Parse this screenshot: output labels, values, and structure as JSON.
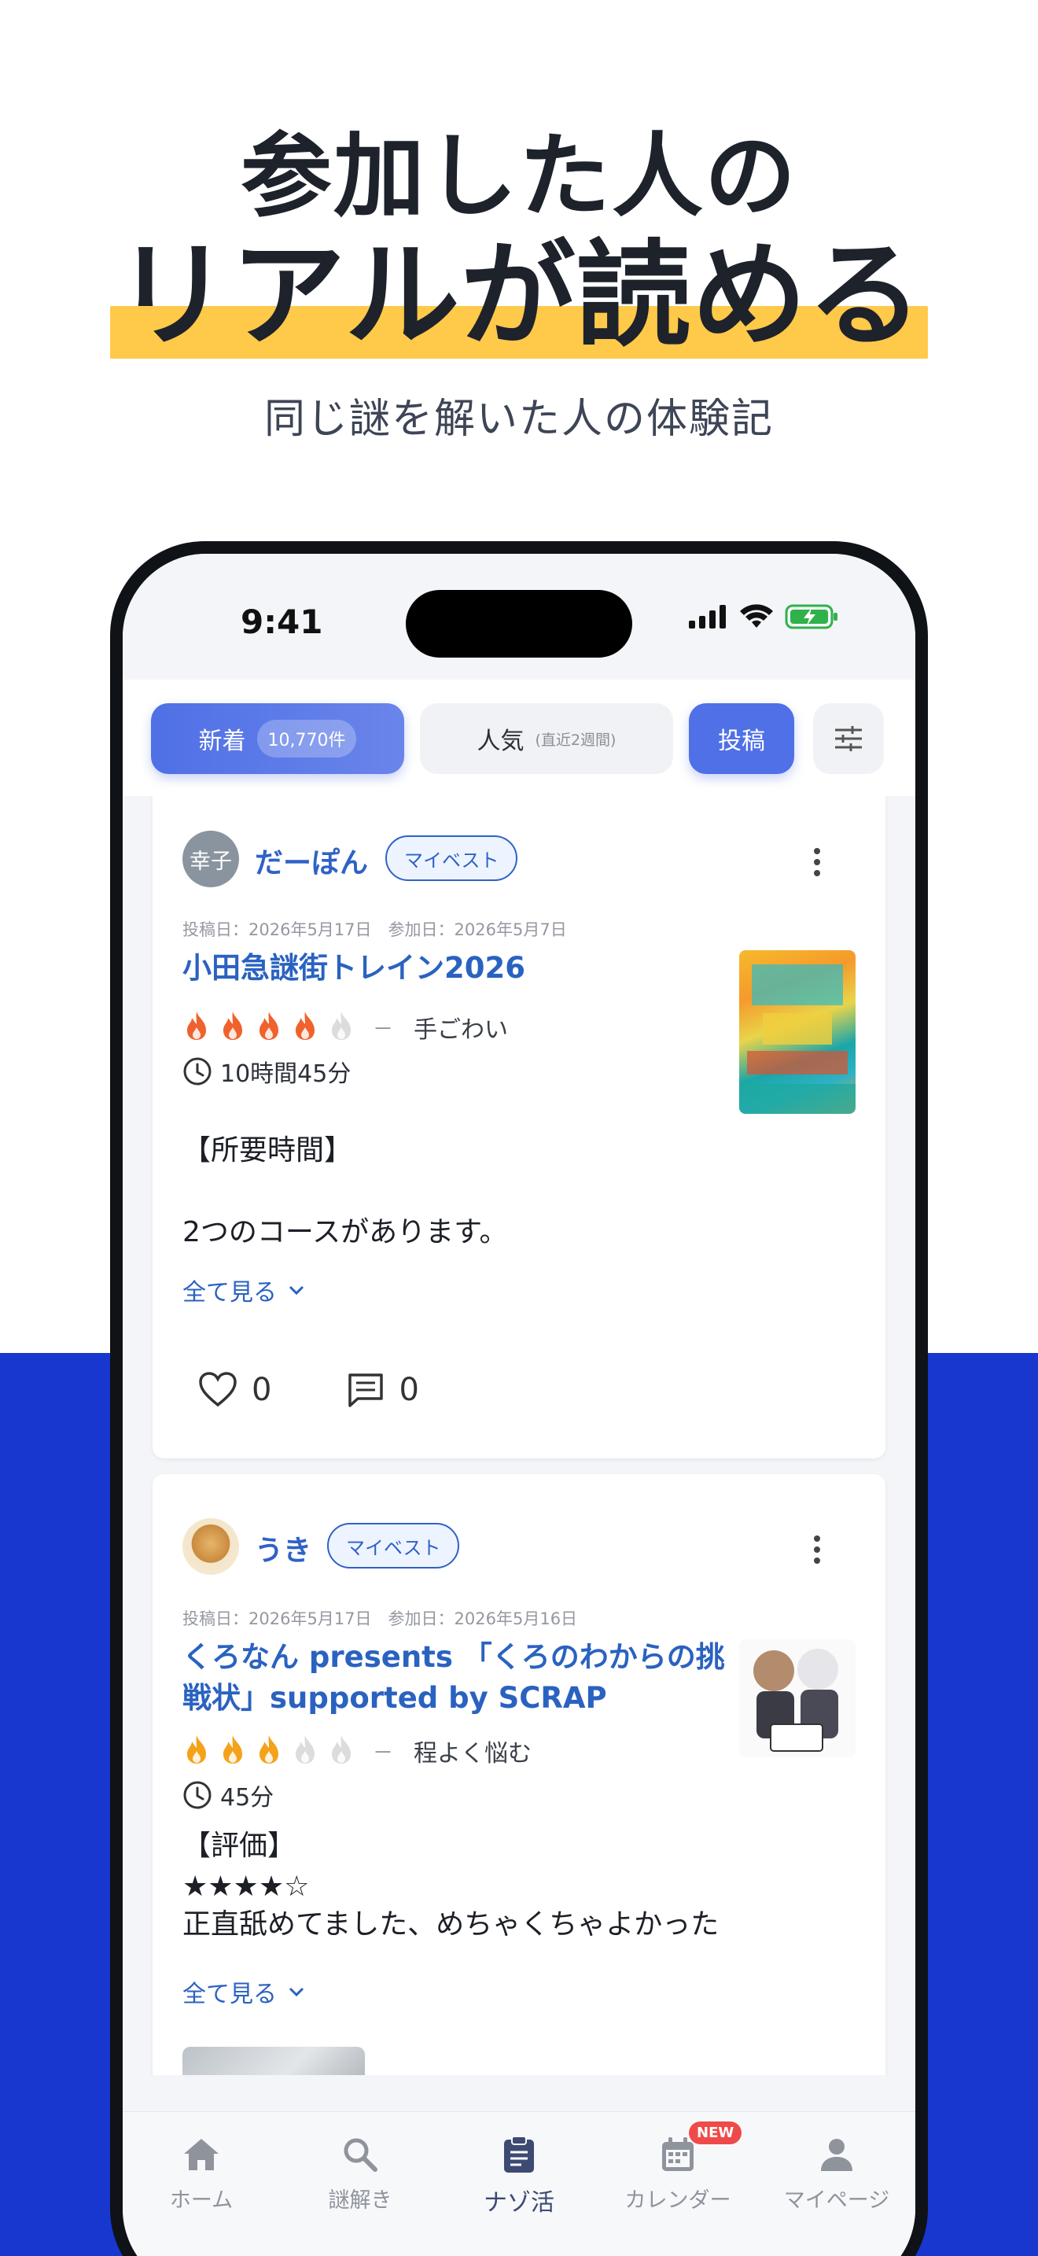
{
  "headline": {
    "line1": "参加した人の",
    "line2": "リアルが読める",
    "sub": "同じ謎を解いた人の体験記"
  },
  "status_bar": {
    "time": "9:41"
  },
  "tabs": {
    "new_label": "新着",
    "new_count": "10,770件",
    "popular_label": "人気",
    "popular_sub": "(直近2週間)",
    "post_label": "投稿"
  },
  "posts": [
    {
      "avatar_text": "幸子",
      "username": "だーぽん",
      "badge": "マイベスト",
      "meta": "投稿日：2026年5月17日　参加日：2026年5月7日",
      "title": "小田急謎街トレイン2026",
      "difficulty_level": 4,
      "difficulty_max": 5,
      "difficulty_dash": "－",
      "difficulty_label": "手ごわい",
      "duration": "10時間45分",
      "body_line1": "【所要時間】",
      "body_line2": "2つのコースがあります。",
      "see_all": "全て見る",
      "likes": "0",
      "comments": "0"
    },
    {
      "username": "うき",
      "badge": "マイベスト",
      "meta": "投稿日：2026年5月17日　参加日：2026年5月16日",
      "title_line1": "くろなん presents 「くろのわからの挑",
      "title_line2": "戦状」supported by SCRAP",
      "difficulty_level": 3,
      "difficulty_max": 5,
      "difficulty_dash": "－",
      "difficulty_label": "程よく悩む",
      "duration": "45分",
      "body_line1": "【評価】",
      "body_line2": "★★★★☆",
      "body_line3": "正直舐めてました、めちゃくちゃよかった",
      "see_all": "全て見る"
    }
  ],
  "bottom_nav": {
    "home": "ホーム",
    "solve": "謎解き",
    "nazokatsu": "ナゾ活",
    "calendar": "カレンダー",
    "calendar_badge": "NEW",
    "mypage": "マイページ"
  },
  "colors": {
    "accent": "#4f70e6",
    "link": "#2a62c0",
    "flame_active": "#f0622d",
    "flame_mid": "#f5a21b",
    "flame_inactive": "#dcdcdc",
    "highlight": "#ffc94a",
    "background_blue": "#1837cf"
  }
}
